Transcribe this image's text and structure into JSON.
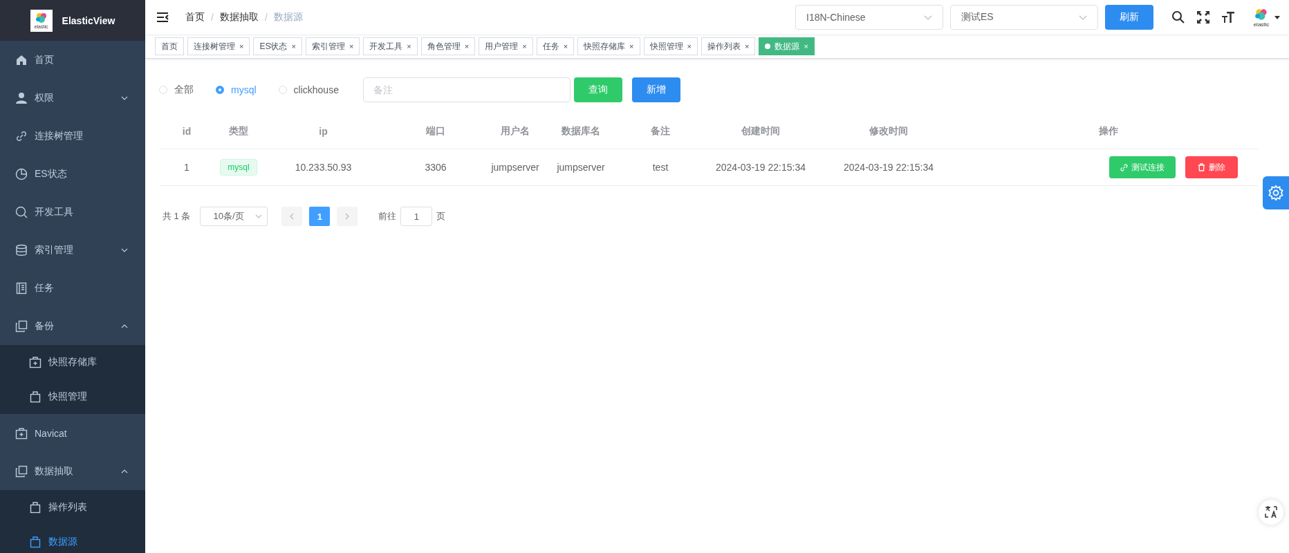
{
  "sidebar": {
    "title": "ElasticView",
    "logo_text": "elastic",
    "items": [
      {
        "label": "首页",
        "selected": false
      },
      {
        "label": "权限",
        "expanded": false,
        "selected": false
      },
      {
        "label": "连接树管理",
        "selected": false
      },
      {
        "label": "ES状态",
        "selected": false
      },
      {
        "label": "开发工具",
        "selected": false
      },
      {
        "label": "索引管理",
        "expanded": false,
        "selected": false
      },
      {
        "label": "任务",
        "selected": false
      },
      {
        "label": "备份",
        "expanded": true,
        "selected": false,
        "children": [
          {
            "label": "快照存储库",
            "selected": false
          },
          {
            "label": "快照管理",
            "selected": false
          }
        ]
      },
      {
        "label": "Navicat",
        "selected": false
      },
      {
        "label": "数据抽取",
        "expanded": true,
        "selected": false,
        "children": [
          {
            "label": "操作列表",
            "selected": false
          },
          {
            "label": "数据源",
            "selected": true
          }
        ]
      }
    ]
  },
  "breadcrumb": [
    "首页",
    "数据抽取",
    "数据源"
  ],
  "breadcrumb_separator": "/",
  "language_select": {
    "value": "I18N-Chinese"
  },
  "connection_select": {
    "value": "测试ES"
  },
  "refresh_button": "刷新",
  "avatar_text": "elastic",
  "tags": [
    {
      "label": "首页",
      "closable": false,
      "selected": false
    },
    {
      "label": "连接树管理",
      "closable": true,
      "selected": false
    },
    {
      "label": "ES状态",
      "closable": true,
      "selected": false
    },
    {
      "label": "索引管理",
      "closable": true,
      "selected": false
    },
    {
      "label": "开发工具",
      "closable": true,
      "selected": false
    },
    {
      "label": "角色管理",
      "closable": true,
      "selected": false
    },
    {
      "label": "用户管理",
      "closable": true,
      "selected": false
    },
    {
      "label": "任务",
      "closable": true,
      "selected": false
    },
    {
      "label": "快照存储库",
      "closable": true,
      "selected": false
    },
    {
      "label": "快照管理",
      "closable": true,
      "selected": false
    },
    {
      "label": "操作列表",
      "closable": true,
      "selected": false
    },
    {
      "label": "数据源",
      "closable": true,
      "selected": true
    }
  ],
  "close_mark": "×",
  "filter": {
    "radios": [
      {
        "label": "全部",
        "selected": false
      },
      {
        "label": "mysql",
        "selected": true
      },
      {
        "label": "clickhouse",
        "selected": false
      }
    ],
    "remark": {
      "placeholder": "备注"
    },
    "query_button": "查询",
    "add_button": "新增"
  },
  "table": {
    "columns": [
      "id",
      "类型",
      "ip",
      "端口",
      "用户名",
      "数据库名",
      "备注",
      "创建时间",
      "修改时间",
      "操作"
    ],
    "rows": [
      {
        "id": "1",
        "type": "mysql",
        "ip": "10.233.50.93",
        "port": "3306",
        "user": "jumpserver",
        "database": "jumpserver",
        "remark": "test",
        "created": "2024-03-19 22:15:34",
        "modified": "2024-03-19 22:15:34",
        "test_button": "测试连接",
        "delete_button": "删除"
      }
    ]
  },
  "pagination": {
    "total": "共 1 条",
    "page_size": "10条/页",
    "pages": [
      {
        "label": "1",
        "selected": true
      }
    ],
    "goto_label": "前往",
    "goto_value": "1",
    "page_suffix": "页"
  }
}
